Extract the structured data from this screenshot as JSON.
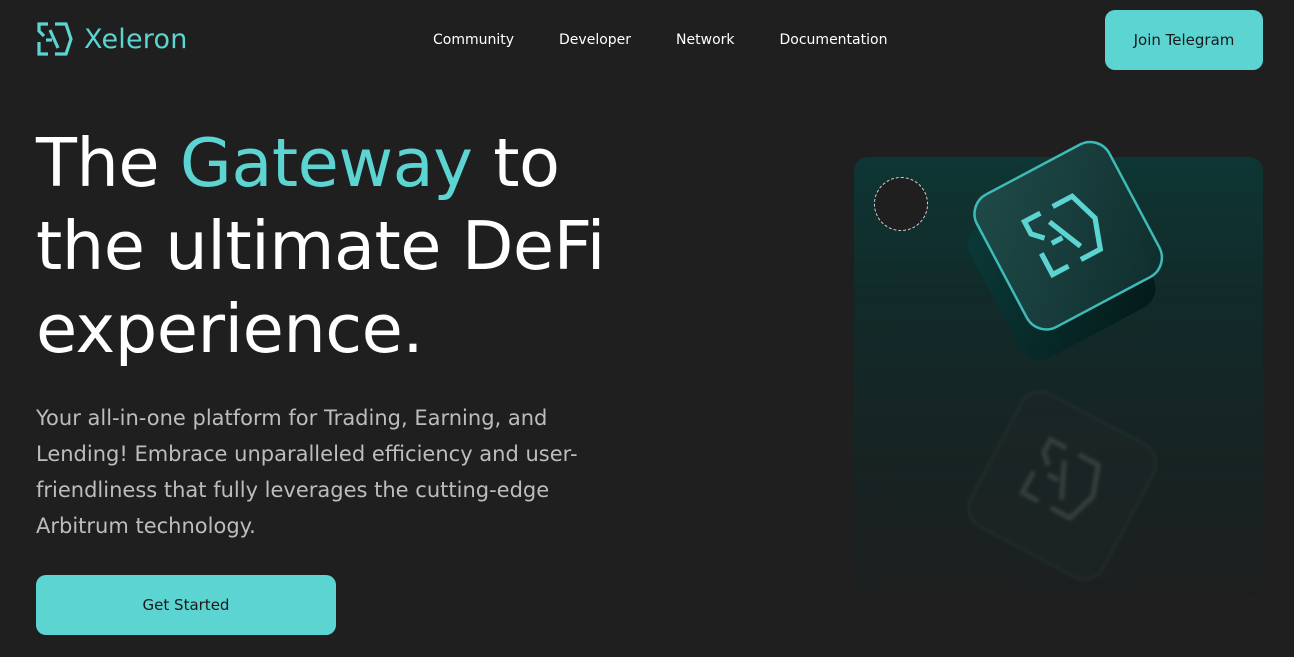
{
  "brand": {
    "name": "Xeleron",
    "accent_color": "#5bd4d2",
    "background_color": "#1f1f1f",
    "logo_icon": "xeleron-logo-icon"
  },
  "nav": {
    "items": [
      {
        "label": "Community"
      },
      {
        "label": "Developer"
      },
      {
        "label": "Network"
      },
      {
        "label": "Documentation"
      }
    ],
    "cta_label": "Join Telegram"
  },
  "hero": {
    "title_prefix": "The ",
    "title_accent": "Gateway",
    "title_suffix": " to the ultimate DeFi experience.",
    "subtitle": "Your all-in-one platform for Trading, Earning, and Lending! Embrace unparalleled efficiency and user-friendliness that fully leverages the cutting-edge Arbitrum technology.",
    "cta_label": "Get Started"
  },
  "illustration": {
    "icon": "xeleron-cube-icon",
    "reflection_icon": "xeleron-cube-reflection-icon"
  }
}
